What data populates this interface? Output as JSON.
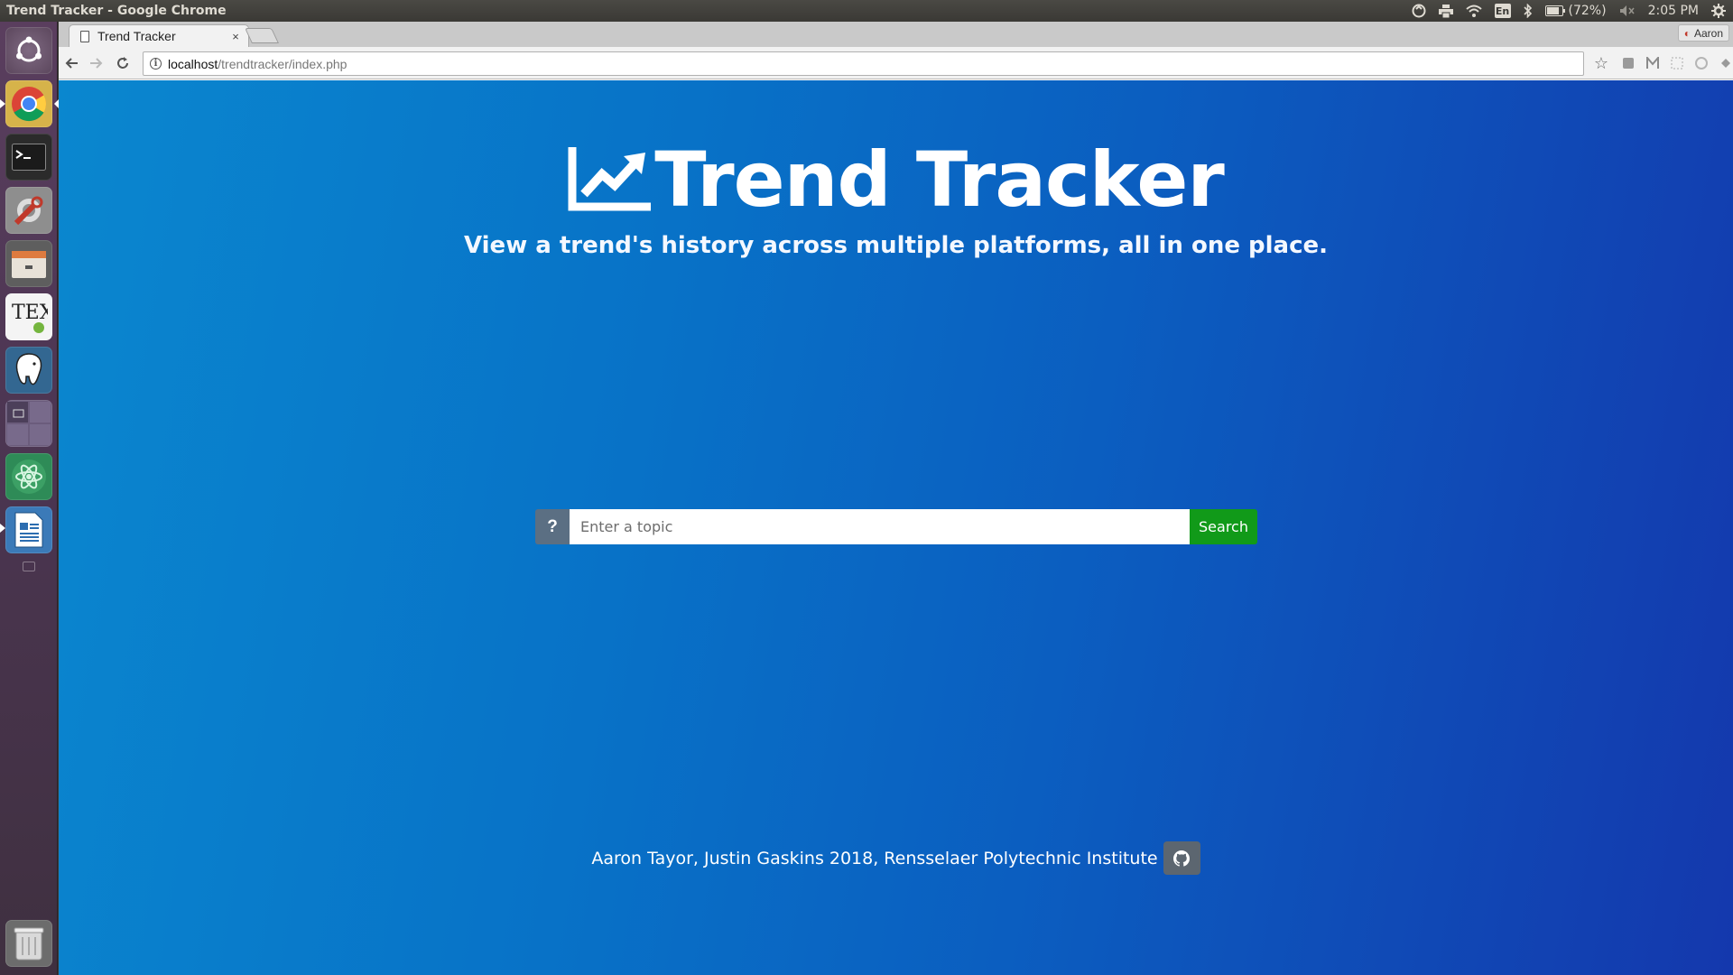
{
  "top_panel": {
    "window_title": "Trend Tracker - Google Chrome",
    "battery": "(72%)",
    "keyboard_layout": "En",
    "time": "2:05 PM",
    "icons": [
      "sync-icon",
      "printer-icon",
      "wifi-icon",
      "keyboard-icon",
      "bluetooth-icon",
      "battery-icon",
      "volume-muted-icon",
      "settings-gear-icon"
    ]
  },
  "launcher": {
    "items": [
      "ubuntu-dash",
      "google-chrome",
      "terminal",
      "system-settings",
      "file-manager",
      "tex-editor",
      "postgresql-admin",
      "workspace-switcher",
      "atom-editor",
      "libreoffice-writer",
      "trash"
    ]
  },
  "browser": {
    "tab_title": "Trend Tracker",
    "tab_close": "×",
    "profile_name": "Aaron",
    "url_host": "localhost",
    "url_path": "/trendtracker/index.php"
  },
  "page": {
    "title": "Trend Tracker",
    "tagline": "View a trend's history across multiple platforms, all in one place.",
    "help_label": "?",
    "search_placeholder": "Enter a topic",
    "search_button": "Search",
    "footer_text": "Aaron Tayor, Justin Gaskins 2018, Rensselaer Polytechnic Institute"
  },
  "colors": {
    "gradient_start": "#0a87cf",
    "gradient_end": "#1438ad",
    "search_button": "#119a19",
    "help_button": "#5b6f83",
    "github_button": "#5c6670"
  }
}
